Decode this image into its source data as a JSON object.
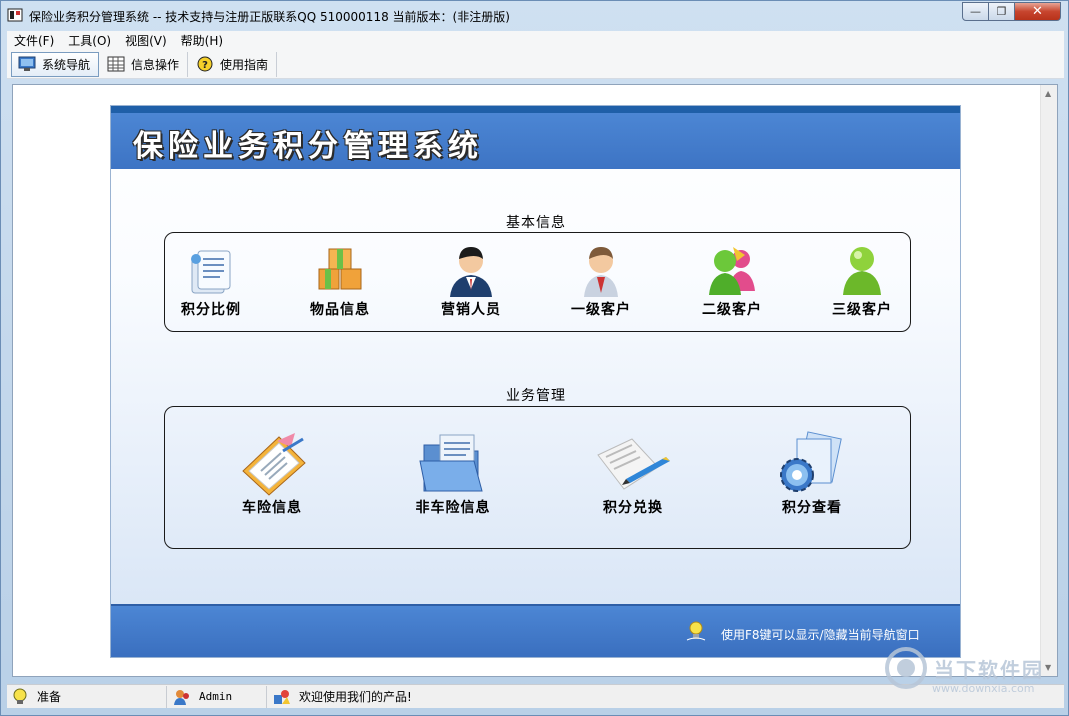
{
  "window": {
    "title": "保险业务积分管理系统 -- 技术支持与注册正版联系QQ 510000118    当前版本：(非注册版)"
  },
  "menu": [
    "文件(F)",
    "工具(O)",
    "视图(V)",
    "帮助(H)"
  ],
  "toolbar": [
    {
      "label": "系统导航",
      "icon": "monitor-icon",
      "active": true
    },
    {
      "label": "信息操作",
      "icon": "grid-icon",
      "active": false
    },
    {
      "label": "使用指南",
      "icon": "help-icon",
      "active": false
    }
  ],
  "panel": {
    "banner_title": "保险业务积分管理系统",
    "basic_info": {
      "title": "基本信息",
      "items": [
        {
          "label": "积分比例",
          "icon": "document-stack-icon"
        },
        {
          "label": "物品信息",
          "icon": "boxes-icon"
        },
        {
          "label": "营销人员",
          "icon": "salesman-icon"
        },
        {
          "label": "一级客户",
          "icon": "customer-icon"
        },
        {
          "label": "二级客户",
          "icon": "user-group-icon"
        },
        {
          "label": "三级客户",
          "icon": "user-icon"
        }
      ]
    },
    "business": {
      "title": "业务管理",
      "items": [
        {
          "label": "车险信息",
          "icon": "clipboard-icon"
        },
        {
          "label": "非车险信息",
          "icon": "folder-icon"
        },
        {
          "label": "积分兑换",
          "icon": "paper-pen-icon"
        },
        {
          "label": "积分查看",
          "icon": "gear-document-icon"
        }
      ]
    },
    "hint": "使用F8键可以显示/隐藏当前导航窗口"
  },
  "status": {
    "ready": "准备",
    "user": "Admin",
    "welcome": "欢迎使用我们的产品!"
  },
  "watermark": {
    "text": "当下软件园",
    "url": "www.downxia.com"
  },
  "colors": {
    "banner": "#4c86d4",
    "topline": "#1f5fa8",
    "close_button": "#c7452e"
  }
}
